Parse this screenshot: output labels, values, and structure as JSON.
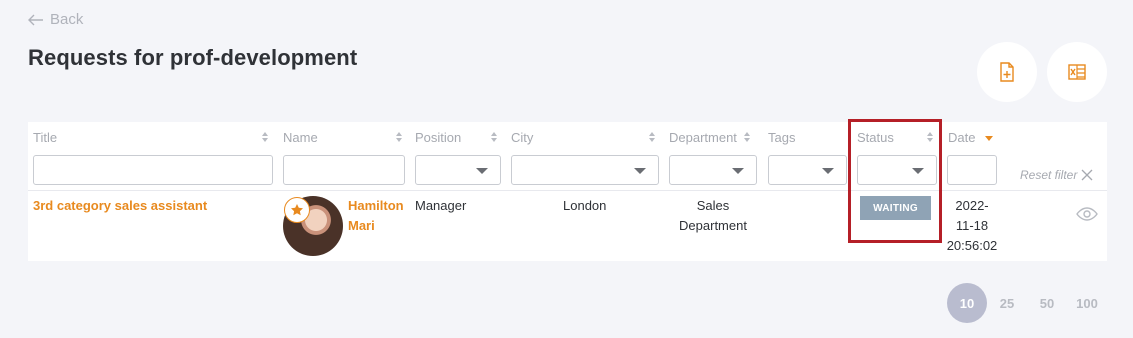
{
  "back_label": "Back",
  "title": "Requests for prof-development",
  "header_buttons": [
    {
      "icon": "add-document-icon"
    },
    {
      "icon": "excel-export-icon"
    }
  ],
  "columns": [
    "Title",
    "Name",
    "Position",
    "City",
    "Department",
    "Tags",
    "Status",
    "Date"
  ],
  "reset_filter_label": "Reset filter",
  "row": {
    "title": "3rd category sales assistant",
    "name_line1": "Hamilton",
    "name_line2": "Mari",
    "position": "Manager",
    "city": "London",
    "department_line1": "Sales",
    "department_line2": "Department",
    "status": "WAITING",
    "date_line1": "2022-",
    "date_line2": "11-18",
    "date_line3": "20:56:02"
  },
  "page_sizes": [
    "10",
    "25",
    "50",
    "100"
  ],
  "selected_page_size": "10",
  "colors": {
    "accent": "#e88a1f",
    "status_waiting": "#8fa3b5",
    "highlight": "#b51f27"
  }
}
